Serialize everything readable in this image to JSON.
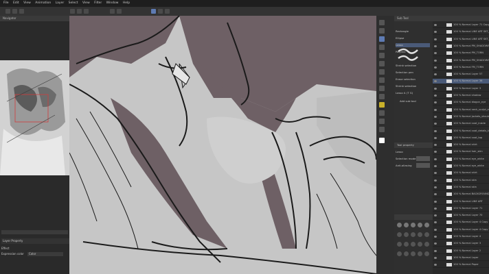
{
  "menubar": {
    "items": [
      "File",
      "Edit",
      "View",
      "Animation",
      "Layer",
      "Select",
      "View",
      "Filter",
      "Window",
      "Help"
    ]
  },
  "navigator": {
    "label": "Navigator"
  },
  "left_bottom": {
    "field_label": "Layer Property",
    "effect_label": "Effect",
    "expression_label": "Expression color",
    "expression_value": "Color"
  },
  "subtool": {
    "header": "Sub Tool",
    "items": [
      "Rectangle",
      "Ellipse",
      "Lasso",
      "Polyline",
      "Shrink selection",
      "Selection pen",
      "Erase selection",
      "Shrink selection",
      "Lasso A (T G)"
    ],
    "add_label": "Add sub tool"
  },
  "tool_property": {
    "header": "Tool property",
    "mode_label": "Lasso",
    "selection_mode": "Selection mode",
    "antialiasing": "Anti-aliasing"
  },
  "layers": {
    "rows": [
      {
        "label": "100 % Normal Layer 71 Copy",
        "selected": false
      },
      {
        "label": "100 % Normal LINE ART SKT_PM_PM_4 COPY",
        "selected": false
      },
      {
        "label": "100 % Normal LINE ART SKT_PM_PM_4",
        "selected": false
      },
      {
        "label": "100 % Normal PM_SHADOWS",
        "selected": false
      },
      {
        "label": "100 % Normal PM_TORN",
        "selected": false
      },
      {
        "label": "100 % Normal PM_SHADOWS",
        "selected": false
      },
      {
        "label": "100 % Normal FM_TORN",
        "selected": false
      },
      {
        "label": "100 % Normal Layer 57",
        "selected": false
      },
      {
        "label": "100 % Normal Layer 36",
        "selected": true
      },
      {
        "label": "100 % Normal Layer 3",
        "selected": false
      },
      {
        "label": "100 % Normal shadow",
        "selected": false
      },
      {
        "label": "100 % Normal diagon_eye",
        "selected": false
      },
      {
        "label": "100 % Normal neck_sculpt_ear_skin",
        "selected": false
      },
      {
        "label": "100 % Normal jackets_shoulder_skin_details",
        "selected": false
      },
      {
        "label": "100 % Normal coat_inside",
        "selected": false
      },
      {
        "label": "100 % Normal coat_details_top_eye_patch",
        "selected": false
      },
      {
        "label": "100 % Normal coat_top",
        "selected": false
      },
      {
        "label": "100 % Normal shirt",
        "selected": false
      },
      {
        "label": "100 % Normal hair_skin",
        "selected": false
      },
      {
        "label": "100 % Normal eye_white",
        "selected": false
      },
      {
        "label": "100 % Normal eye_white",
        "selected": false
      },
      {
        "label": "100 % Normal shirt",
        "selected": false
      },
      {
        "label": "100 % Normal skin",
        "selected": false
      },
      {
        "label": "100 % Normal skin",
        "selected": false
      },
      {
        "label": "100 % Normal BACKGROUND",
        "selected": false
      },
      {
        "label": "100 % Normal LINE ART",
        "selected": false
      },
      {
        "label": "100 % Normal Layer 71",
        "selected": false
      },
      {
        "label": "100 % Normal Layer 70",
        "selected": false
      },
      {
        "label": "100 % Normal Layer 4 Copy",
        "selected": false
      },
      {
        "label": "100 % Normal Layer 4 Copy 2",
        "selected": false
      },
      {
        "label": "100 % Normal Layer 4",
        "selected": false
      },
      {
        "label": "100 % Normal Layer 3",
        "selected": false
      },
      {
        "label": "100 % Normal Layer 2",
        "selected": false
      },
      {
        "label": "100 % Normal Layer",
        "selected": false
      },
      {
        "label": "100 % Normal Paper",
        "selected": false
      }
    ]
  },
  "colors": {
    "canvas_bg": "#c6c6c6",
    "shadow": "#6e6065",
    "line": "#1a1a1a"
  }
}
